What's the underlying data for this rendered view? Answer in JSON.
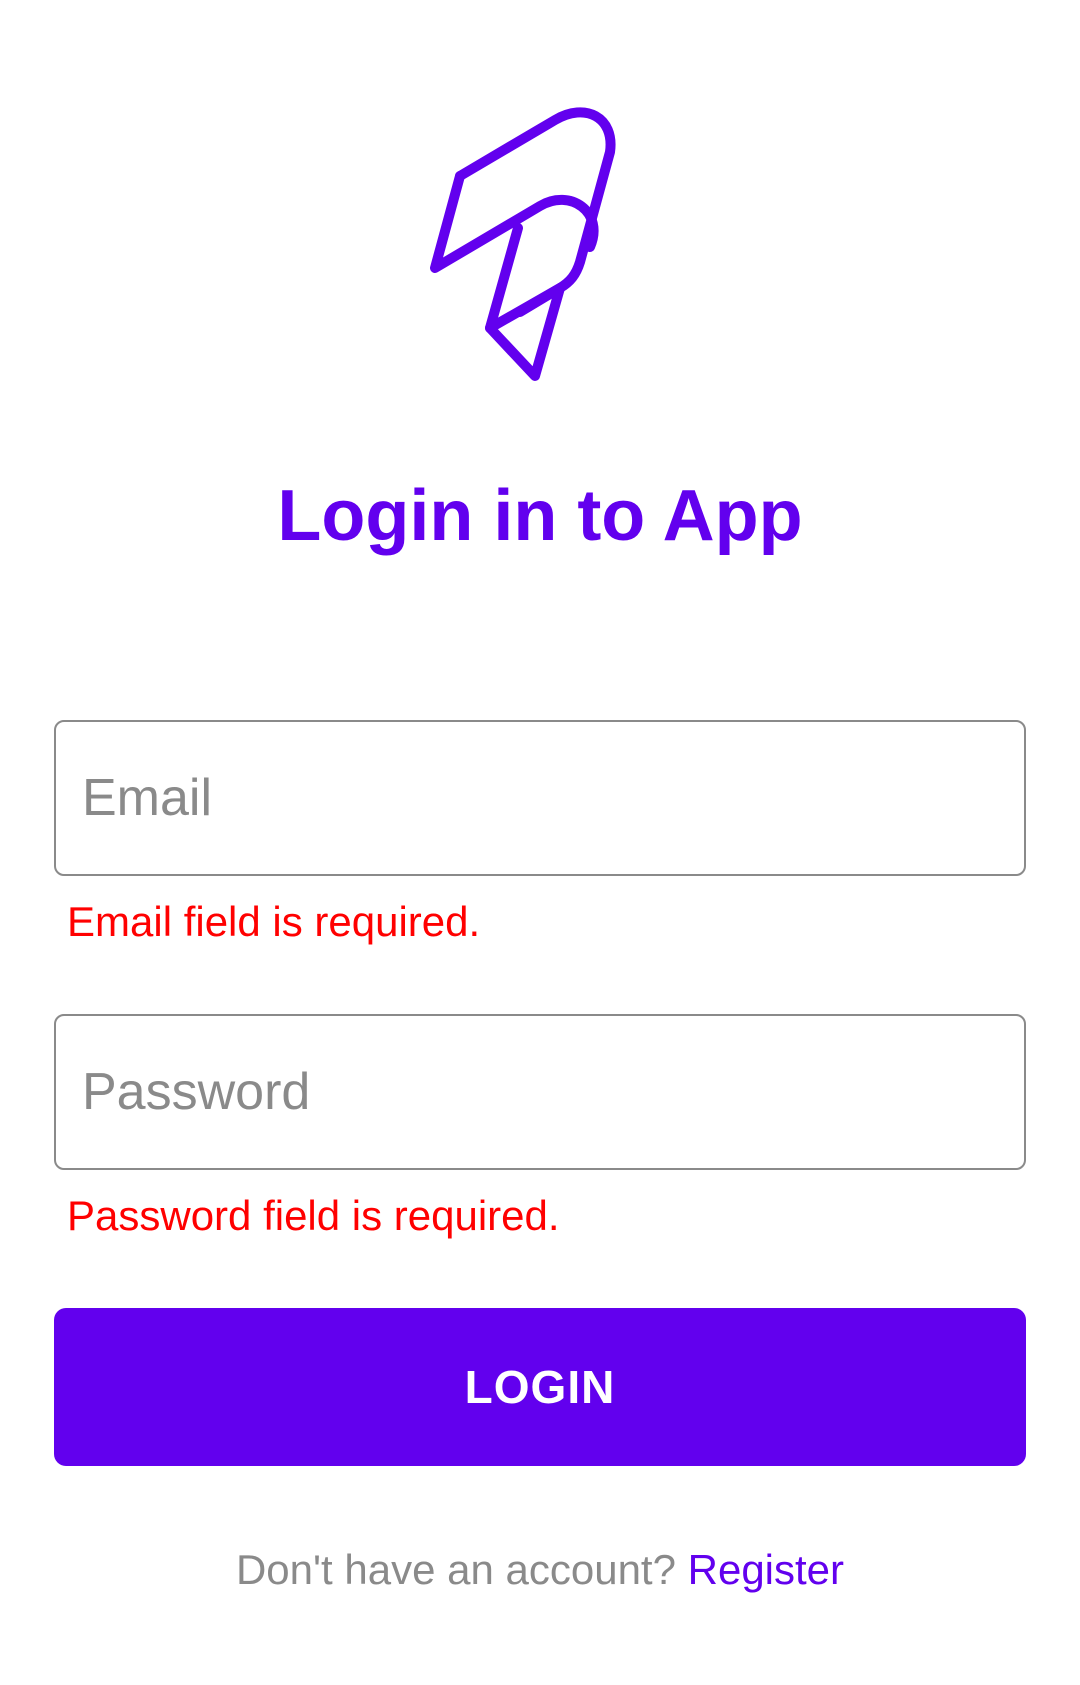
{
  "app": {
    "title": "Login in to App",
    "logo_icon": "rocket-logo-icon",
    "accent_color": "#6200EE",
    "error_color": "#FF0000"
  },
  "form": {
    "email": {
      "placeholder": "Email",
      "value": "",
      "error": "Email field is required."
    },
    "password": {
      "placeholder": "Password",
      "value": "",
      "error": "Password field is required."
    },
    "login_label": "LOGIN"
  },
  "footer": {
    "prompt": "Don't have an account?",
    "register_label": "Register"
  }
}
